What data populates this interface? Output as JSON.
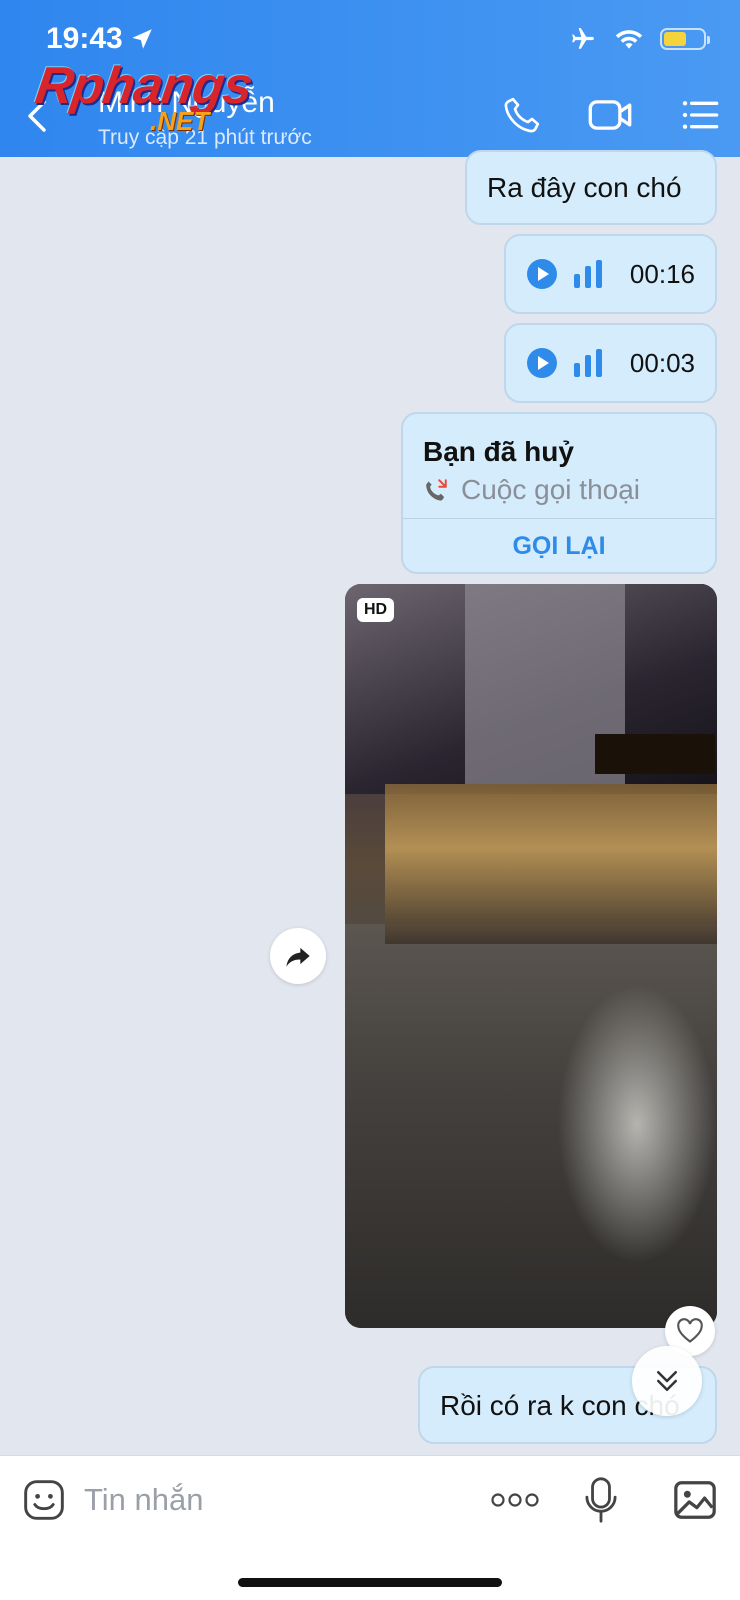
{
  "status_bar": {
    "time": "19:43"
  },
  "header": {
    "contact_name": "Minh Nguyễn",
    "contact_status": "Truy cập 21 phút trước",
    "watermark": "Rphangs",
    "watermark_sub": ".NET"
  },
  "messages": [
    {
      "type": "text",
      "text": "Ra đây con chó"
    },
    {
      "type": "voice",
      "duration": "00:16"
    },
    {
      "type": "voice",
      "duration": "00:03"
    },
    {
      "type": "call",
      "title": "Bạn đã huỷ",
      "call_type": "Cuộc gọi thoại",
      "action": "GỌI LẠI"
    },
    {
      "type": "photo",
      "badge": "HD"
    },
    {
      "type": "text",
      "text": "Rồi có ra k con chó"
    }
  ],
  "composer": {
    "placeholder": "Tin nhắn"
  },
  "colors": {
    "header_start": "#2f86ee",
    "accent": "#2e8bea",
    "bubble": "#d4ecfb",
    "background": "#e2e7ef"
  }
}
